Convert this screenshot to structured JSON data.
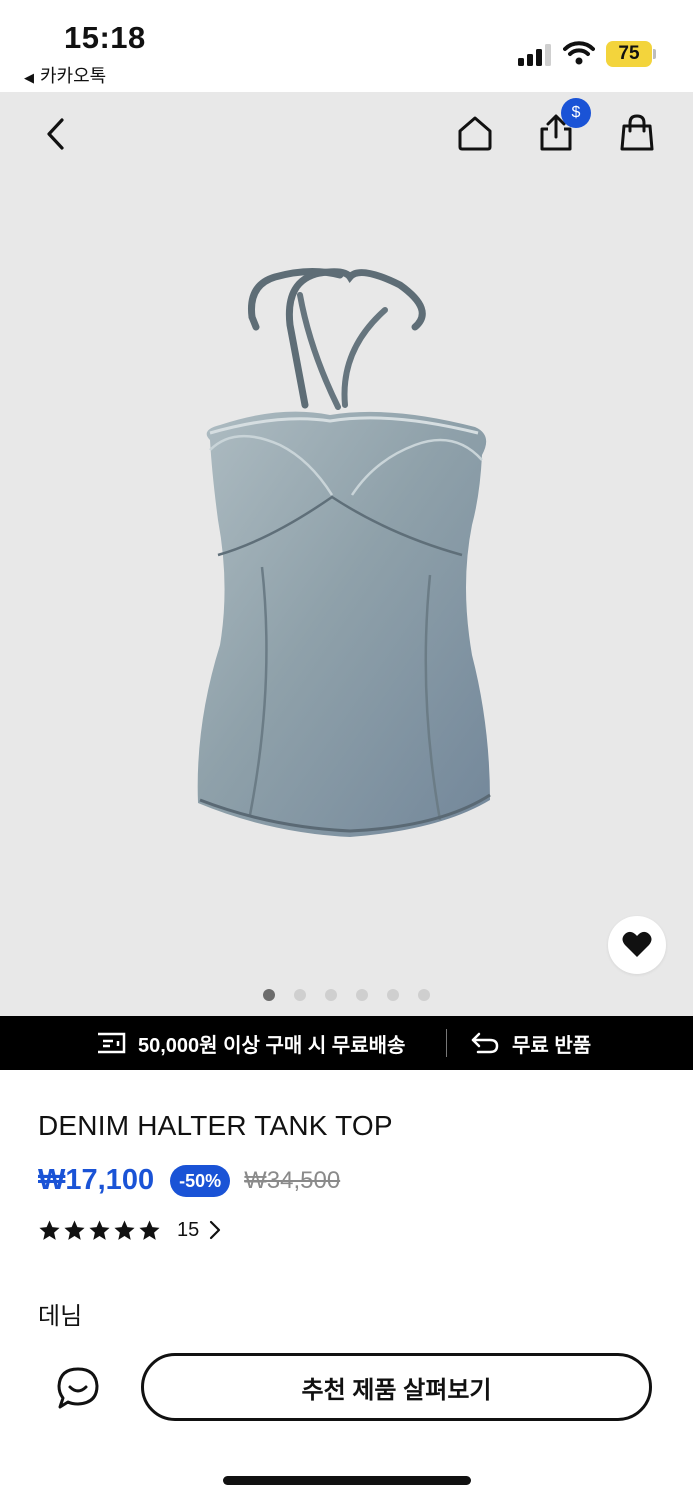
{
  "status_bar": {
    "time": "15:18",
    "back_app": "카카오톡",
    "battery": "75",
    "icons": [
      "signal-icon",
      "wifi-icon",
      "battery-icon"
    ]
  },
  "nav": {
    "icons": [
      "back-chevron-icon",
      "home-icon",
      "share-icon",
      "bag-icon"
    ],
    "coin_badge": "$"
  },
  "gallery": {
    "total_images": 6,
    "active_index": 0
  },
  "promo": {
    "shipping_text": "50,000원 이상 구매 시 무료배송",
    "return_text": "무료 반품"
  },
  "product": {
    "title": "DENIM HALTER TANK TOP",
    "price": "₩17,100",
    "discount": "-50%",
    "original_price": "₩34,500",
    "rating_stars": 5,
    "review_count": "15",
    "section_label": "데님"
  },
  "bottom_bar": {
    "cta_label": "추천 제품 살펴보기",
    "chat_icon": "chat-bubble-icon"
  },
  "colors": {
    "accent": "#1a53d6",
    "promo_bg": "#000000",
    "hero_bg": "#e8e8e8",
    "battery": "#f3d43c"
  }
}
